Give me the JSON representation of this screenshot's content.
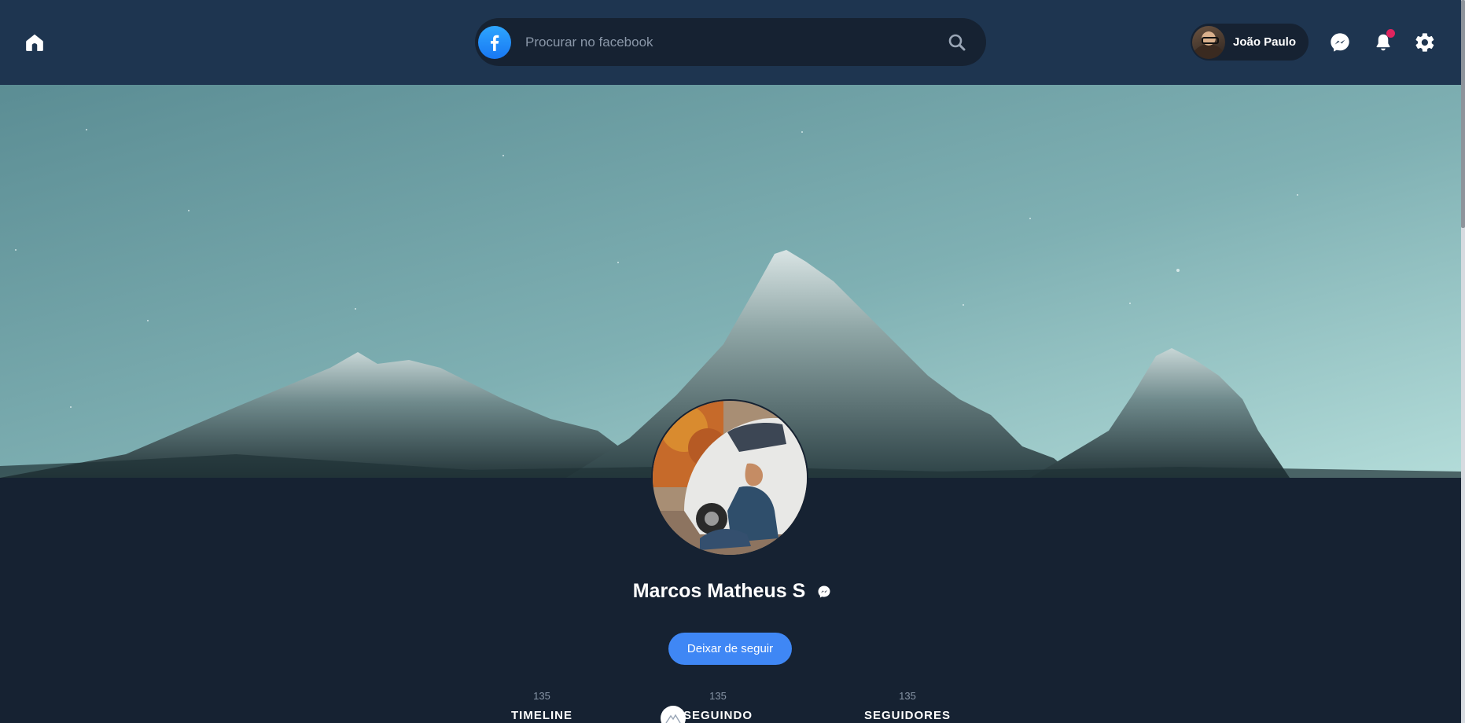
{
  "header": {
    "search": {
      "placeholder": "Procurar no facebook",
      "value": ""
    },
    "user": {
      "name": "João Paulo"
    },
    "notifications": {
      "has_unread": true
    }
  },
  "profile": {
    "name": "Marcos Matheus S",
    "follow_button_label": "Deixar de seguir",
    "stats": [
      {
        "count": "135",
        "label": "TIMELINE"
      },
      {
        "count": "135",
        "label": "SEGUINDO"
      },
      {
        "count": "135",
        "label": "SEGUIDORES"
      }
    ]
  },
  "colors": {
    "topbar_bg": "#1e3550",
    "page_bg": "#162232",
    "accent_blue": "#3f87f5",
    "notification_dot": "#e0245e",
    "facebook_blue": "#1877f2"
  },
  "icons": {
    "home": "home-icon",
    "logo": "facebook-logo-icon",
    "search": "search-icon",
    "messenger": "messenger-icon",
    "notifications": "bell-icon",
    "settings": "gear-icon"
  }
}
